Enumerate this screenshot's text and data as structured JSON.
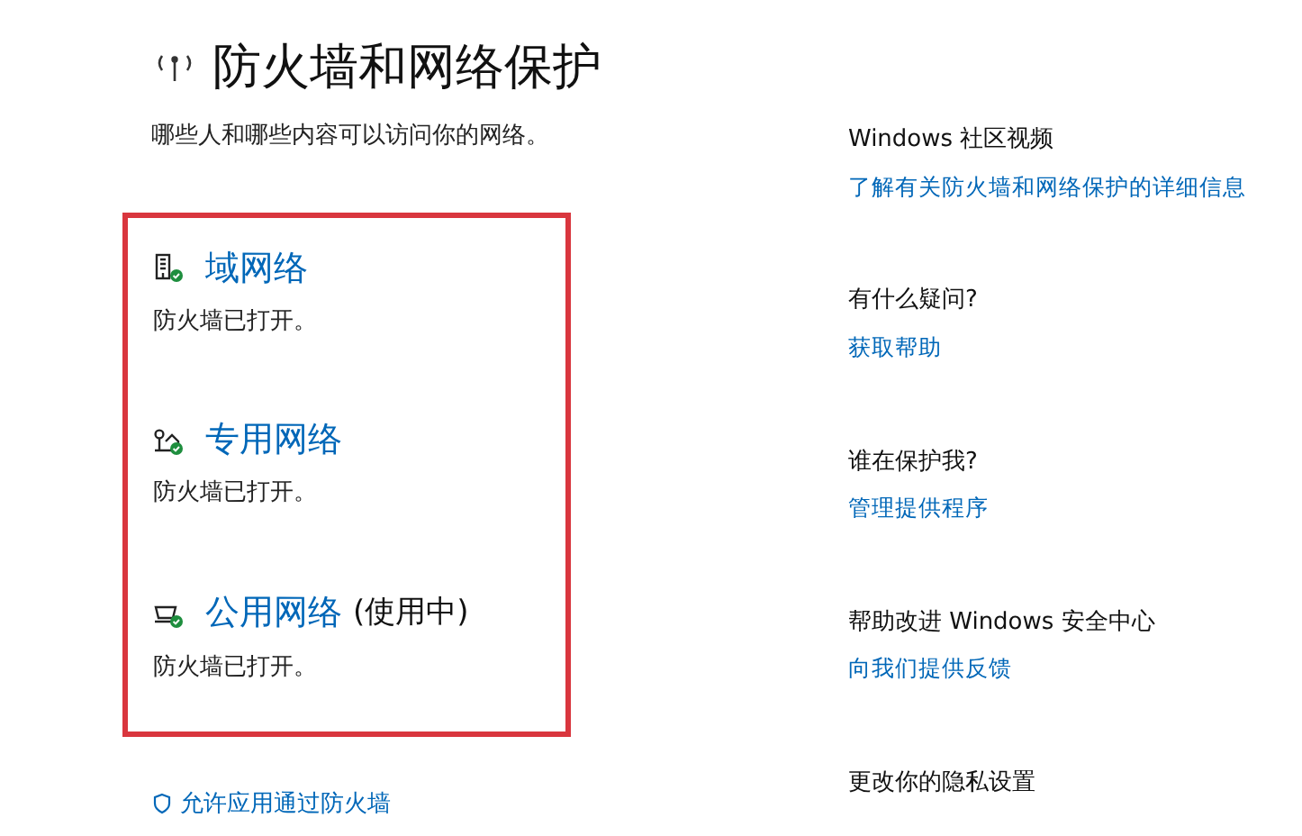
{
  "header": {
    "title": "防火墙和网络保护",
    "subtitle": "哪些人和哪些内容可以访问你的网络。"
  },
  "networks": [
    {
      "kind": "domain",
      "name": "域网络",
      "status": "防火墙已打开。"
    },
    {
      "kind": "private",
      "name": "专用网络",
      "status": "防火墙已打开。"
    },
    {
      "kind": "public",
      "name": "公用网络",
      "tag": "(使用中)",
      "status": "防火墙已打开。"
    }
  ],
  "bottom_link": "允许应用通过防火墙",
  "sidebar": [
    {
      "heading": "Windows 社区视频",
      "link": "了解有关防火墙和网络保护的详细信息"
    },
    {
      "heading": "有什么疑问?",
      "link": "获取帮助"
    },
    {
      "heading": "谁在保护我?",
      "link": "管理提供程序"
    },
    {
      "heading": "帮助改进 Windows 安全中心",
      "link": "向我们提供反馈"
    },
    {
      "heading": "更改你的隐私设置"
    }
  ]
}
